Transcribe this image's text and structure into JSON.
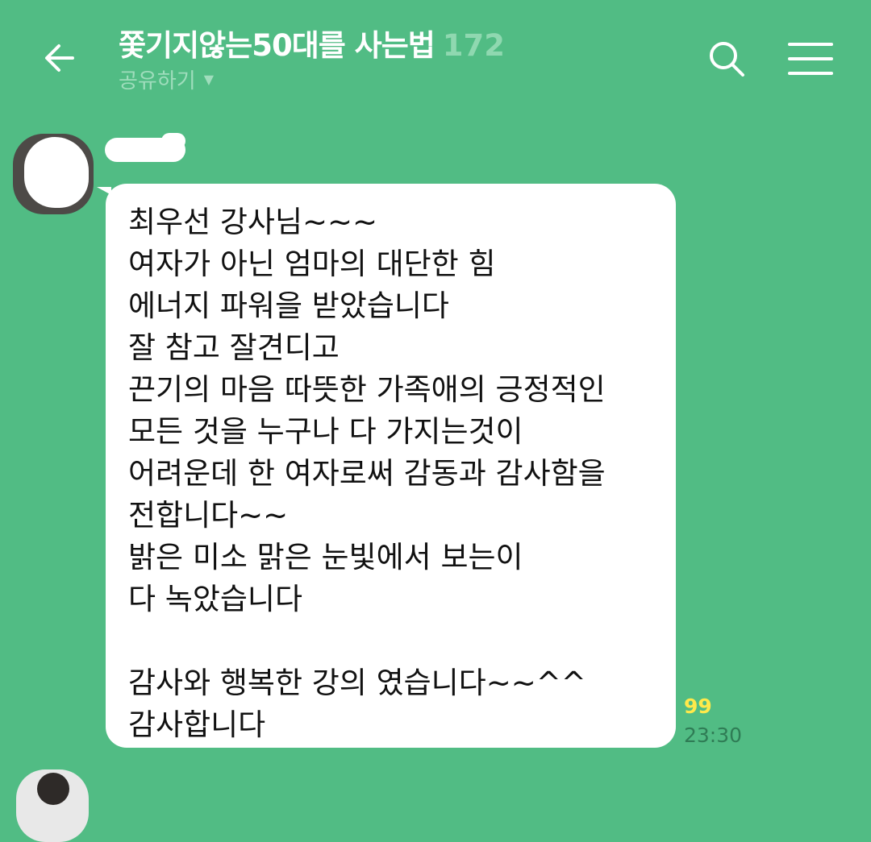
{
  "header": {
    "room_title": "쫓기지않는50대를 사는법",
    "member_count": "172",
    "share_label": "공유하기",
    "back_icon": "arrow-left-icon",
    "search_icon": "search-icon",
    "menu_icon": "hamburger-menu-icon"
  },
  "message": {
    "lines": [
      "최우선 강사님~~~",
      "여자가 아닌 엄마의 대단한 힘",
      "에너지 파워을 받았습니다",
      "잘 참고 잘견디고",
      "끈기의 마음 따뜻한 가족애의 긍정적인",
      "모든 것을 누구나 다 가지는것이",
      "어려운데 한 여자로써 감동과 감사함을",
      "전합니다~~",
      "밝은 미소 맑은 눈빛에서 보는이",
      "다 녹았습니다",
      "",
      "감사와 행복한 강의 였습니다~~^^",
      "감사합니다"
    ],
    "unread_count": "99",
    "time": "23:30"
  },
  "colors": {
    "background": "#51bc84",
    "bubble": "#ffffff",
    "unread": "#ffe94a"
  }
}
